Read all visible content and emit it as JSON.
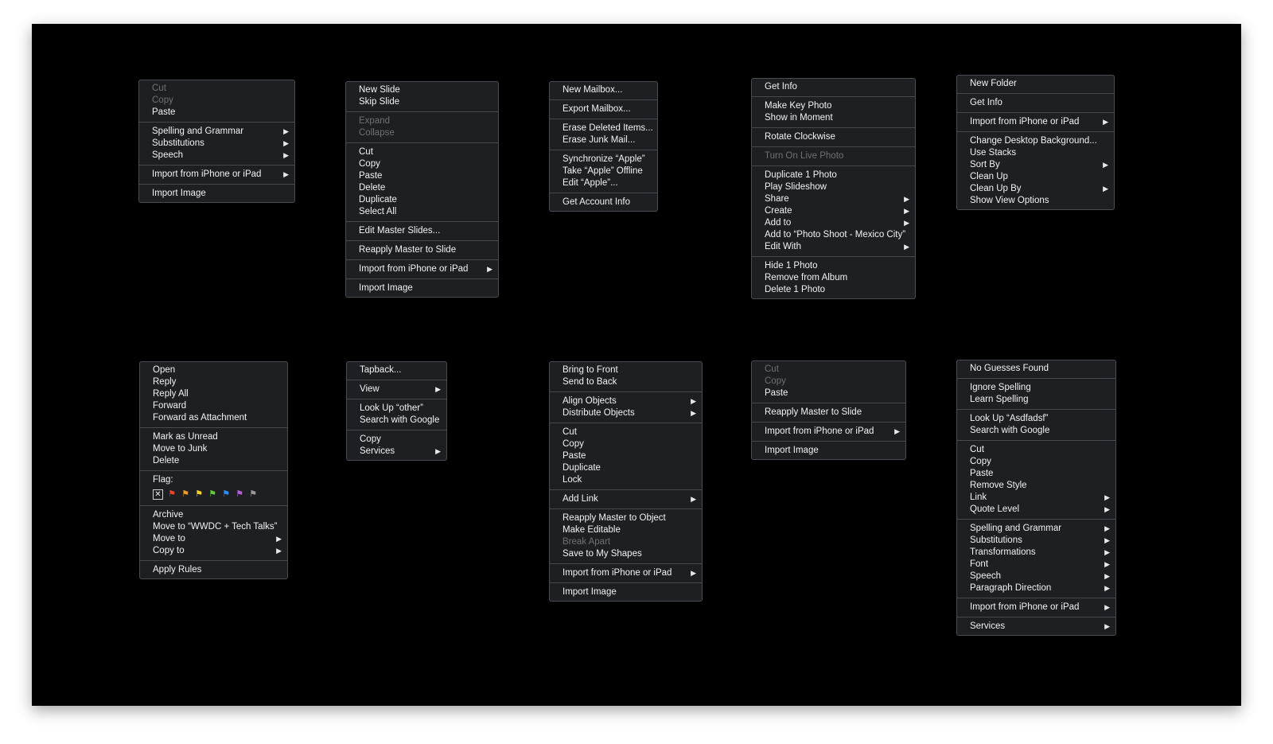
{
  "menus": [
    {
      "id": "edit-image",
      "groups": [
        [
          {
            "label": "Cut",
            "disabled": true
          },
          {
            "label": "Copy",
            "disabled": true
          },
          {
            "label": "Paste"
          }
        ],
        [
          {
            "label": "Spelling and Grammar",
            "submenu": true
          },
          {
            "label": "Substitutions",
            "submenu": true
          },
          {
            "label": "Speech",
            "submenu": true
          }
        ],
        [
          {
            "label": "Import from iPhone or iPad",
            "submenu": true
          }
        ],
        [
          {
            "label": "Import Image"
          }
        ]
      ]
    },
    {
      "id": "keynote-slide",
      "groups": [
        [
          {
            "label": "New Slide"
          },
          {
            "label": "Skip Slide"
          }
        ],
        [
          {
            "label": "Expand",
            "disabled": true
          },
          {
            "label": "Collapse",
            "disabled": true
          }
        ],
        [
          {
            "label": "Cut"
          },
          {
            "label": "Copy"
          },
          {
            "label": "Paste"
          },
          {
            "label": "Delete"
          },
          {
            "label": "Duplicate"
          },
          {
            "label": "Select All"
          }
        ],
        [
          {
            "label": "Edit Master Slides..."
          }
        ],
        [
          {
            "label": "Reapply Master to Slide"
          }
        ],
        [
          {
            "label": "Import from iPhone or iPad",
            "submenu": true
          }
        ],
        [
          {
            "label": "Import Image"
          }
        ]
      ]
    },
    {
      "id": "mail-mailbox",
      "groups": [
        [
          {
            "label": "New Mailbox..."
          }
        ],
        [
          {
            "label": "Export Mailbox..."
          }
        ],
        [
          {
            "label": "Erase Deleted Items..."
          },
          {
            "label": "Erase Junk Mail..."
          }
        ],
        [
          {
            "label": "Synchronize “Apple”"
          },
          {
            "label": "Take “Apple” Offline"
          },
          {
            "label": "Edit “Apple”..."
          }
        ],
        [
          {
            "label": "Get Account Info"
          }
        ]
      ]
    },
    {
      "id": "photos-photo",
      "groups": [
        [
          {
            "label": "Get Info"
          }
        ],
        [
          {
            "label": "Make Key Photo"
          },
          {
            "label": "Show in Moment"
          }
        ],
        [
          {
            "label": "Rotate Clockwise"
          }
        ],
        [
          {
            "label": "Turn On Live Photo",
            "disabled": true
          }
        ],
        [
          {
            "label": "Duplicate 1 Photo"
          },
          {
            "label": "Play Slideshow"
          },
          {
            "label": "Share",
            "submenu": true
          },
          {
            "label": "Create",
            "submenu": true
          },
          {
            "label": "Add to",
            "submenu": true
          },
          {
            "label": "Add to “Photo Shoot - Mexico City”"
          },
          {
            "label": "Edit With",
            "submenu": true
          }
        ],
        [
          {
            "label": "Hide 1 Photo"
          },
          {
            "label": "Remove from Album"
          },
          {
            "label": "Delete 1 Photo"
          }
        ]
      ]
    },
    {
      "id": "finder-desktop",
      "groups": [
        [
          {
            "label": "New Folder"
          }
        ],
        [
          {
            "label": "Get Info"
          }
        ],
        [
          {
            "label": "Import from iPhone or iPad",
            "submenu": true
          }
        ],
        [
          {
            "label": "Change Desktop Background..."
          },
          {
            "label": "Use Stacks"
          },
          {
            "label": "Sort By",
            "submenu": true
          },
          {
            "label": "Clean Up"
          },
          {
            "label": "Clean Up By",
            "submenu": true
          },
          {
            "label": "Show View Options"
          }
        ]
      ]
    },
    {
      "id": "mail-message",
      "groups": [
        [
          {
            "label": "Open"
          },
          {
            "label": "Reply"
          },
          {
            "label": "Reply All"
          },
          {
            "label": "Forward"
          },
          {
            "label": "Forward as Attachment"
          }
        ],
        [
          {
            "label": "Mark as Unread"
          },
          {
            "label": "Move to Junk"
          },
          {
            "label": "Delete"
          }
        ],
        [
          {
            "label": "Flag:",
            "flags": true
          }
        ],
        [
          {
            "label": "Archive"
          },
          {
            "label": "Move to “WWDC + Tech Talks”"
          },
          {
            "label": "Move to",
            "submenu": true
          },
          {
            "label": "Copy to",
            "submenu": true
          }
        ],
        [
          {
            "label": "Apply Rules"
          }
        ]
      ]
    },
    {
      "id": "messages-bubble",
      "groups": [
        [
          {
            "label": "Tapback..."
          }
        ],
        [
          {
            "label": "View",
            "submenu": true
          }
        ],
        [
          {
            "label": "Look Up “other”"
          },
          {
            "label": "Search with Google"
          }
        ],
        [
          {
            "label": "Copy"
          },
          {
            "label": "Services",
            "submenu": true
          }
        ]
      ]
    },
    {
      "id": "keynote-object",
      "groups": [
        [
          {
            "label": "Bring to Front"
          },
          {
            "label": "Send to Back"
          }
        ],
        [
          {
            "label": "Align Objects",
            "submenu": true
          },
          {
            "label": "Distribute Objects",
            "submenu": true
          }
        ],
        [
          {
            "label": "Cut"
          },
          {
            "label": "Copy"
          },
          {
            "label": "Paste"
          },
          {
            "label": "Duplicate"
          },
          {
            "label": "Lock"
          }
        ],
        [
          {
            "label": "Add Link",
            "submenu": true
          }
        ],
        [
          {
            "label": "Reapply Master to Object"
          },
          {
            "label": "Make Editable"
          },
          {
            "label": "Break Apart",
            "disabled": true
          },
          {
            "label": "Save to My Shapes"
          }
        ],
        [
          {
            "label": "Import from iPhone or iPad",
            "submenu": true
          }
        ],
        [
          {
            "label": "Import Image"
          }
        ]
      ]
    },
    {
      "id": "keynote-canvas",
      "groups": [
        [
          {
            "label": "Cut",
            "disabled": true
          },
          {
            "label": "Copy",
            "disabled": true
          },
          {
            "label": "Paste"
          }
        ],
        [
          {
            "label": "Reapply Master to Slide"
          }
        ],
        [
          {
            "label": "Import from iPhone or iPad",
            "submenu": true
          }
        ],
        [
          {
            "label": "Import Image"
          }
        ]
      ]
    },
    {
      "id": "text-spelling",
      "groups": [
        [
          {
            "label": "No Guesses Found"
          }
        ],
        [
          {
            "label": "Ignore Spelling"
          },
          {
            "label": "Learn Spelling"
          }
        ],
        [
          {
            "label": "Look Up “Asdfadsf”"
          },
          {
            "label": "Search with Google"
          }
        ],
        [
          {
            "label": "Cut"
          },
          {
            "label": "Copy"
          },
          {
            "label": "Paste"
          },
          {
            "label": "Remove Style"
          },
          {
            "label": "Link",
            "submenu": true
          },
          {
            "label": "Quote Level",
            "submenu": true
          }
        ],
        [
          {
            "label": "Spelling and Grammar",
            "submenu": true
          },
          {
            "label": "Substitutions",
            "submenu": true
          },
          {
            "label": "Transformations",
            "submenu": true
          },
          {
            "label": "Font",
            "submenu": true
          },
          {
            "label": "Speech",
            "submenu": true
          },
          {
            "label": "Paragraph Direction",
            "submenu": true
          }
        ],
        [
          {
            "label": "Import from iPhone or iPad",
            "submenu": true
          }
        ],
        [
          {
            "label": "Services",
            "submenu": true
          }
        ]
      ]
    }
  ],
  "flag_colors": [
    "#e8452c",
    "#f29a1d",
    "#f5d22a",
    "#5fd03a",
    "#2f8cf0",
    "#b45fe0",
    "#9a9a9a"
  ],
  "flag_none_glyph": "✕",
  "submenu_arrow": "▶"
}
